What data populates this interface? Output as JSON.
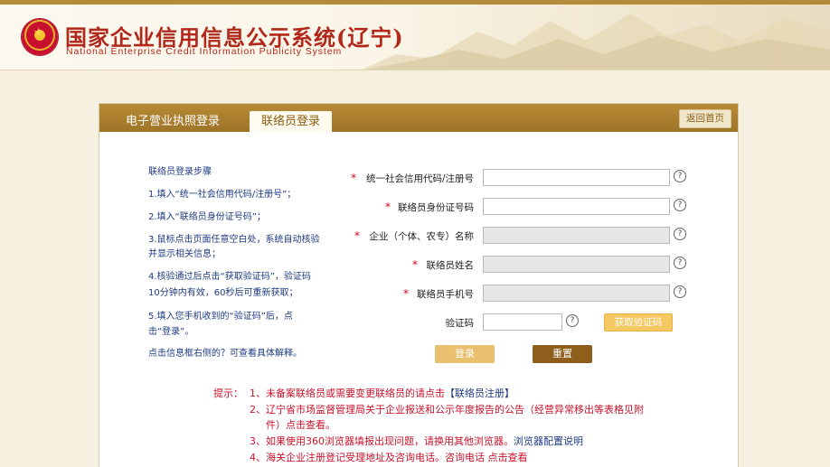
{
  "header": {
    "title": "国家企业信用信息公示系统(辽宁)",
    "subtitle": "National Enterprise Credit Information Publicity System"
  },
  "tabs": [
    {
      "label": "电子营业执照登录",
      "active": false
    },
    {
      "label": "联络员登录",
      "active": true
    }
  ],
  "back_button": "返回首页",
  "steps": {
    "title": "联络员登录步骤",
    "lines": [
      "1.填入“统一社会信用代码/注册号”；",
      "2.填入“联络员身份证号码”；",
      "3.鼠标点击页面任意空白处，系统自动核验",
      "并显示相关信息；",
      "4.核验通过后点击“获取验证码”，验证码",
      "10分钟内有效，60秒后可重新获取；",
      "5.填入您手机收到的“验证码”后，点",
      "击“登录”。"
    ],
    "hint": "点击信息框右侧的？可查看具体解释。"
  },
  "form": {
    "required_mark": "*",
    "help_icon": "?",
    "fields": [
      {
        "label": "统一社会信用代码/注册号",
        "value": "",
        "readonly": false
      },
      {
        "label": "联络员身份证号码",
        "value": "",
        "readonly": false
      },
      {
        "label": "企业（个体、农专）名称",
        "value": "",
        "readonly": true
      },
      {
        "label": "联络员姓名",
        "value": "",
        "readonly": true
      },
      {
        "label": "联络员手机号",
        "value": "",
        "readonly": true
      }
    ],
    "captcha_label": "验证码",
    "captcha_value": "",
    "get_code_button": "获取验证码",
    "login_button": "登录",
    "reset_button": "重置"
  },
  "notes": {
    "prefix": "提示：",
    "n1_text": "1、未备案联络员或需要变更联络员的请点击",
    "n1_link": "【联络员注册】",
    "n2_line1": "2、辽宁省市场监督管理局关于企业报送和公示年度报告的公告（经营异常移出等表格见附",
    "n2_line2": "件）点击查看。",
    "n3_text": "3、如果使用360浏览器填报出现问题，请换用其他浏览器。",
    "n3_link": "浏览器配置说明",
    "n4_text": "4、海关企业注册登记受理地址及咨询电话。咨询电话 点击查看"
  },
  "colors": {
    "brand_red": "#b1271a",
    "panel_gold": "#a87b2d",
    "note_red": "#c8132b",
    "link_blue": "#1d3a82"
  }
}
